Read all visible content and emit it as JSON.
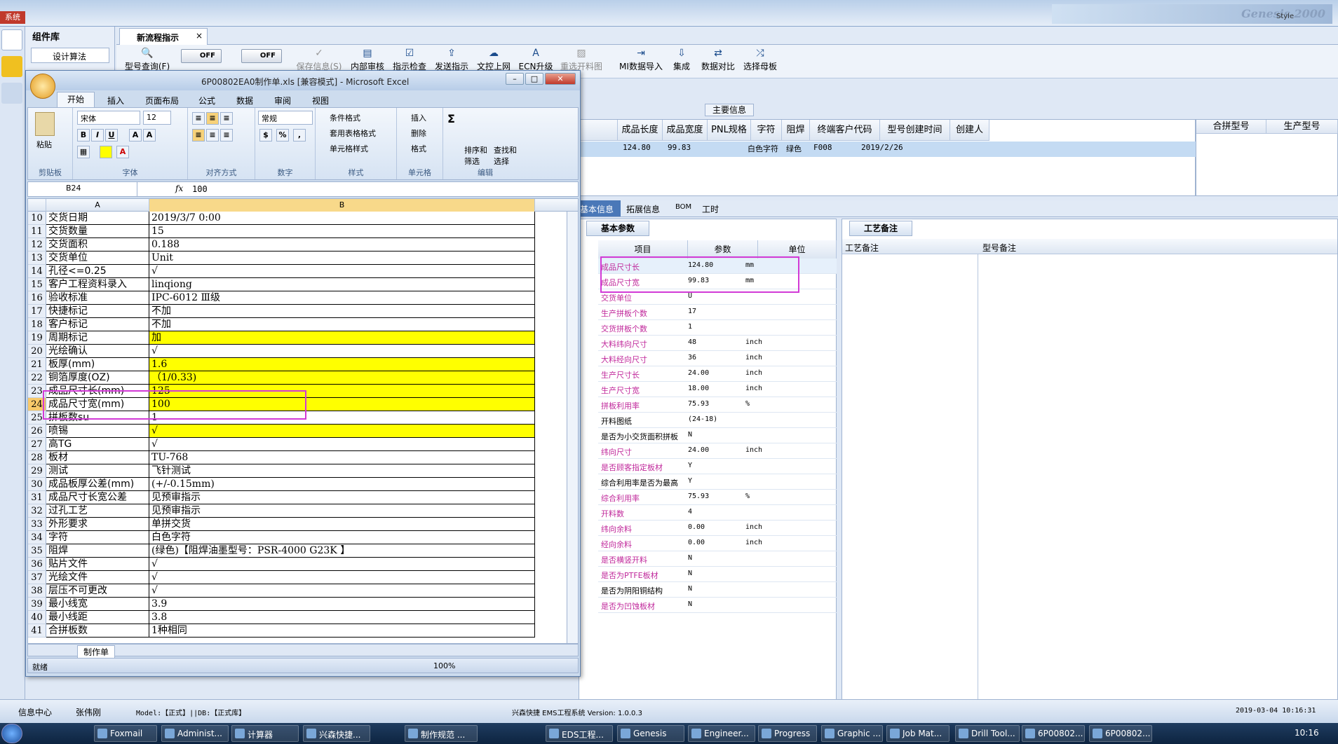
{
  "system": {
    "menu_label": "系统",
    "banner_text": "Genesis 2000",
    "style_label": "Style"
  },
  "complib": {
    "title": "组件库",
    "design_algo": "设计算法"
  },
  "tab": {
    "label": "新流程指示"
  },
  "toolbar": {
    "items": [
      "型号查询(F)",
      "保存信息(S)",
      "内部审核",
      "指示检查",
      "发送指示",
      "文控上网",
      "ECN升级",
      "重选开料图",
      "MI数据导入",
      "集成",
      "数据对比",
      "选择母板"
    ],
    "off1": "OFF",
    "off2": "OFF"
  },
  "maininfo": {
    "header": "主要信息",
    "columns": [
      "成品长度",
      "成品宽度",
      "PNL规格",
      "字符",
      "阻焊",
      "终端客户代码",
      "型号创建时间",
      "创建人"
    ],
    "row": [
      "124.80",
      "99.83",
      "",
      "白色字符",
      "绿色",
      "F008",
      "2019/2/26",
      ""
    ],
    "right_columns": [
      "合拼型号",
      "生产型号"
    ]
  },
  "subtabs": [
    "基本信息",
    "拓展信息",
    "BOM",
    "工时"
  ],
  "basic": {
    "title": "基本参数",
    "columns": [
      "项目",
      "参数",
      "单位"
    ],
    "rows": [
      {
        "name": "成品尺寸长",
        "value": "124.80",
        "unit": "mm",
        "pink": true
      },
      {
        "name": "成品尺寸宽",
        "value": "99.83",
        "unit": "mm",
        "pink": true
      },
      {
        "name": "交货单位",
        "value": "U",
        "unit": "",
        "pink": true
      },
      {
        "name": "生产拼板个数",
        "value": "17",
        "unit": "",
        "pink": true
      },
      {
        "name": "交货拼板个数",
        "value": "1",
        "unit": "",
        "pink": true
      },
      {
        "name": "大料纬向尺寸",
        "value": "48",
        "unit": "inch",
        "pink": true
      },
      {
        "name": "大料经向尺寸",
        "value": "36",
        "unit": "inch",
        "pink": true
      },
      {
        "name": "生产尺寸长",
        "value": "24.00",
        "unit": "inch",
        "pink": true
      },
      {
        "name": "生产尺寸宽",
        "value": "18.00",
        "unit": "inch",
        "pink": true
      },
      {
        "name": "拼板利用率",
        "value": "75.93",
        "unit": "%",
        "pink": true
      },
      {
        "name": "开料图纸",
        "value": "(24-18)",
        "unit": "",
        "pink": false
      },
      {
        "name": "是否为小交货面积拼板",
        "value": "N",
        "unit": "",
        "pink": false
      },
      {
        "name": "纬向尺寸",
        "value": "24.00",
        "unit": "inch",
        "pink": true
      },
      {
        "name": "是否顾客指定板材",
        "value": "Y",
        "unit": "",
        "pink": true
      },
      {
        "name": "综合利用率是否为最高",
        "value": "Y",
        "unit": "",
        "pink": false
      },
      {
        "name": "综合利用率",
        "value": "75.93",
        "unit": "%",
        "pink": true
      },
      {
        "name": "开料数",
        "value": "4",
        "unit": "",
        "pink": true
      },
      {
        "name": "纬向余料",
        "value": "0.00",
        "unit": "inch",
        "pink": true
      },
      {
        "name": "经向余料",
        "value": "0.00",
        "unit": "inch",
        "pink": true
      },
      {
        "name": "是否横竖开料",
        "value": "N",
        "unit": "",
        "pink": true
      },
      {
        "name": "是否为PTFE板材",
        "value": "N",
        "unit": "",
        "pink": true
      },
      {
        "name": "是否为阴阳铜结构",
        "value": "N",
        "unit": "",
        "pink": false
      },
      {
        "name": "是否为凹蚀板材",
        "value": "N",
        "unit": "",
        "pink": true
      }
    ]
  },
  "process": {
    "title": "工艺备注",
    "col1": "工艺备注",
    "col2": "型号备注"
  },
  "excel": {
    "title": "6P00802EA0制作单.xls [兼容模式] - Microsoft Excel",
    "ribbon_tabs": [
      "开始",
      "插入",
      "页面布局",
      "公式",
      "数据",
      "审阅",
      "视图"
    ],
    "font_name": "宋体",
    "font_size": "12",
    "number_format": "常规",
    "groups": [
      "剪贴板",
      "字体",
      "对齐方式",
      "数字",
      "样式",
      "单元格",
      "编辑"
    ],
    "paste": "粘贴",
    "style_btns": [
      "条件格式",
      "套用表格格式",
      "单元格样式"
    ],
    "cell_btns": [
      "插入",
      "删除",
      "格式"
    ],
    "edit_btns": [
      "排序和筛选",
      "查找和选择"
    ],
    "name_box": "B24",
    "formula": "100",
    "col_a": "A",
    "col_b": "B",
    "rows": [
      {
        "n": "10",
        "a": "交货日期",
        "b": "2019/3/7 0:00",
        "y": false
      },
      {
        "n": "11",
        "a": "交货数量",
        "b": "15",
        "y": false
      },
      {
        "n": "12",
        "a": "交货面积",
        "b": "0.188",
        "y": false
      },
      {
        "n": "13",
        "a": "交货单位",
        "b": "Unit",
        "y": false
      },
      {
        "n": "14",
        "a": "孔径<=0.25",
        "b": "√",
        "y": false
      },
      {
        "n": "15",
        "a": "客户工程资料录入",
        "b": "linqiong",
        "y": false
      },
      {
        "n": "16",
        "a": "验收标准",
        "b": "IPC-6012 Ⅲ级",
        "y": false
      },
      {
        "n": "17",
        "a": "快捷标记",
        "b": "不加",
        "y": false
      },
      {
        "n": "18",
        "a": "客户标记",
        "b": "不加",
        "y": false
      },
      {
        "n": "19",
        "a": "周期标记",
        "b": "加",
        "y": true
      },
      {
        "n": "20",
        "a": "光绘确认",
        "b": "√",
        "y": false
      },
      {
        "n": "21",
        "a": "板厚(mm)",
        "b": "1.6",
        "y": true
      },
      {
        "n": "22",
        "a": "铜箔厚度(OZ)",
        "b": "（1/0.33)",
        "y": true
      },
      {
        "n": "23",
        "a": "成品尺寸长(mm)",
        "b": "125",
        "y": true
      },
      {
        "n": "24",
        "a": "成品尺寸宽(mm)",
        "b": "100",
        "y": true
      },
      {
        "n": "25",
        "a": "拼板数su",
        "b": "1",
        "y": false
      },
      {
        "n": "26",
        "a": "喷锡",
        "b": "√",
        "y": true
      },
      {
        "n": "27",
        "a": "高TG",
        "b": "√",
        "y": false
      },
      {
        "n": "28",
        "a": "板材",
        "b": "TU-768",
        "y": false
      },
      {
        "n": "29",
        "a": "测试",
        "b": "飞针测试",
        "y": false
      },
      {
        "n": "30",
        "a": "成品板厚公差(mm)",
        "b": "(+/-0.15mm)",
        "y": false
      },
      {
        "n": "31",
        "a": "成品尺寸长宽公差",
        "b": "见预审指示",
        "y": false
      },
      {
        "n": "32",
        "a": "过孔工艺",
        "b": "见预审指示",
        "y": false
      },
      {
        "n": "33",
        "a": "外形要求",
        "b": "单拼交货",
        "y": false
      },
      {
        "n": "34",
        "a": "字符",
        "b": "白色字符",
        "y": false
      },
      {
        "n": "35",
        "a": "阻焊",
        "b": "(绿色)【阻焊油墨型号：PSR-4000 G23K 】",
        "y": false
      },
      {
        "n": "36",
        "a": "贴片文件",
        "b": "√",
        "y": false
      },
      {
        "n": "37",
        "a": "光绘文件",
        "b": "√",
        "y": false
      },
      {
        "n": "38",
        "a": "层压不可更改",
        "b": "√",
        "y": false
      },
      {
        "n": "39",
        "a": "最小线宽",
        "b": "3.9",
        "y": false
      },
      {
        "n": "40",
        "a": "最小线距",
        "b": "3.8",
        "y": false
      },
      {
        "n": "41",
        "a": "合拼板数",
        "b": "1种相同",
        "y": false
      }
    ],
    "sheet_tab": "制作单",
    "status": "就绪",
    "zoom": "100%"
  },
  "statusbar": {
    "info_center": "信息中心",
    "user": "张伟刚",
    "model": "Model:【正式】||DB:【正式库】",
    "system": "兴森快捷 EMS工程系统 Version: 1.0.0.3",
    "datetime": "2019-03-04 10:16:31"
  },
  "taskbar": {
    "items": [
      "Foxmail",
      "Administ...",
      "计算器",
      "兴森快捷...",
      "制作规范 ...",
      "EDS工程...",
      "Genesis",
      "Engineer...",
      "Progress",
      "Graphic ...",
      "Job Mat...",
      "Drill Tool...",
      "6P00802...",
      "6P00802..."
    ],
    "time": "10:16"
  },
  "colors": {
    "highlight": "#d23ad6",
    "yellow": "#ffff00",
    "pink_text": "#c0289b"
  }
}
